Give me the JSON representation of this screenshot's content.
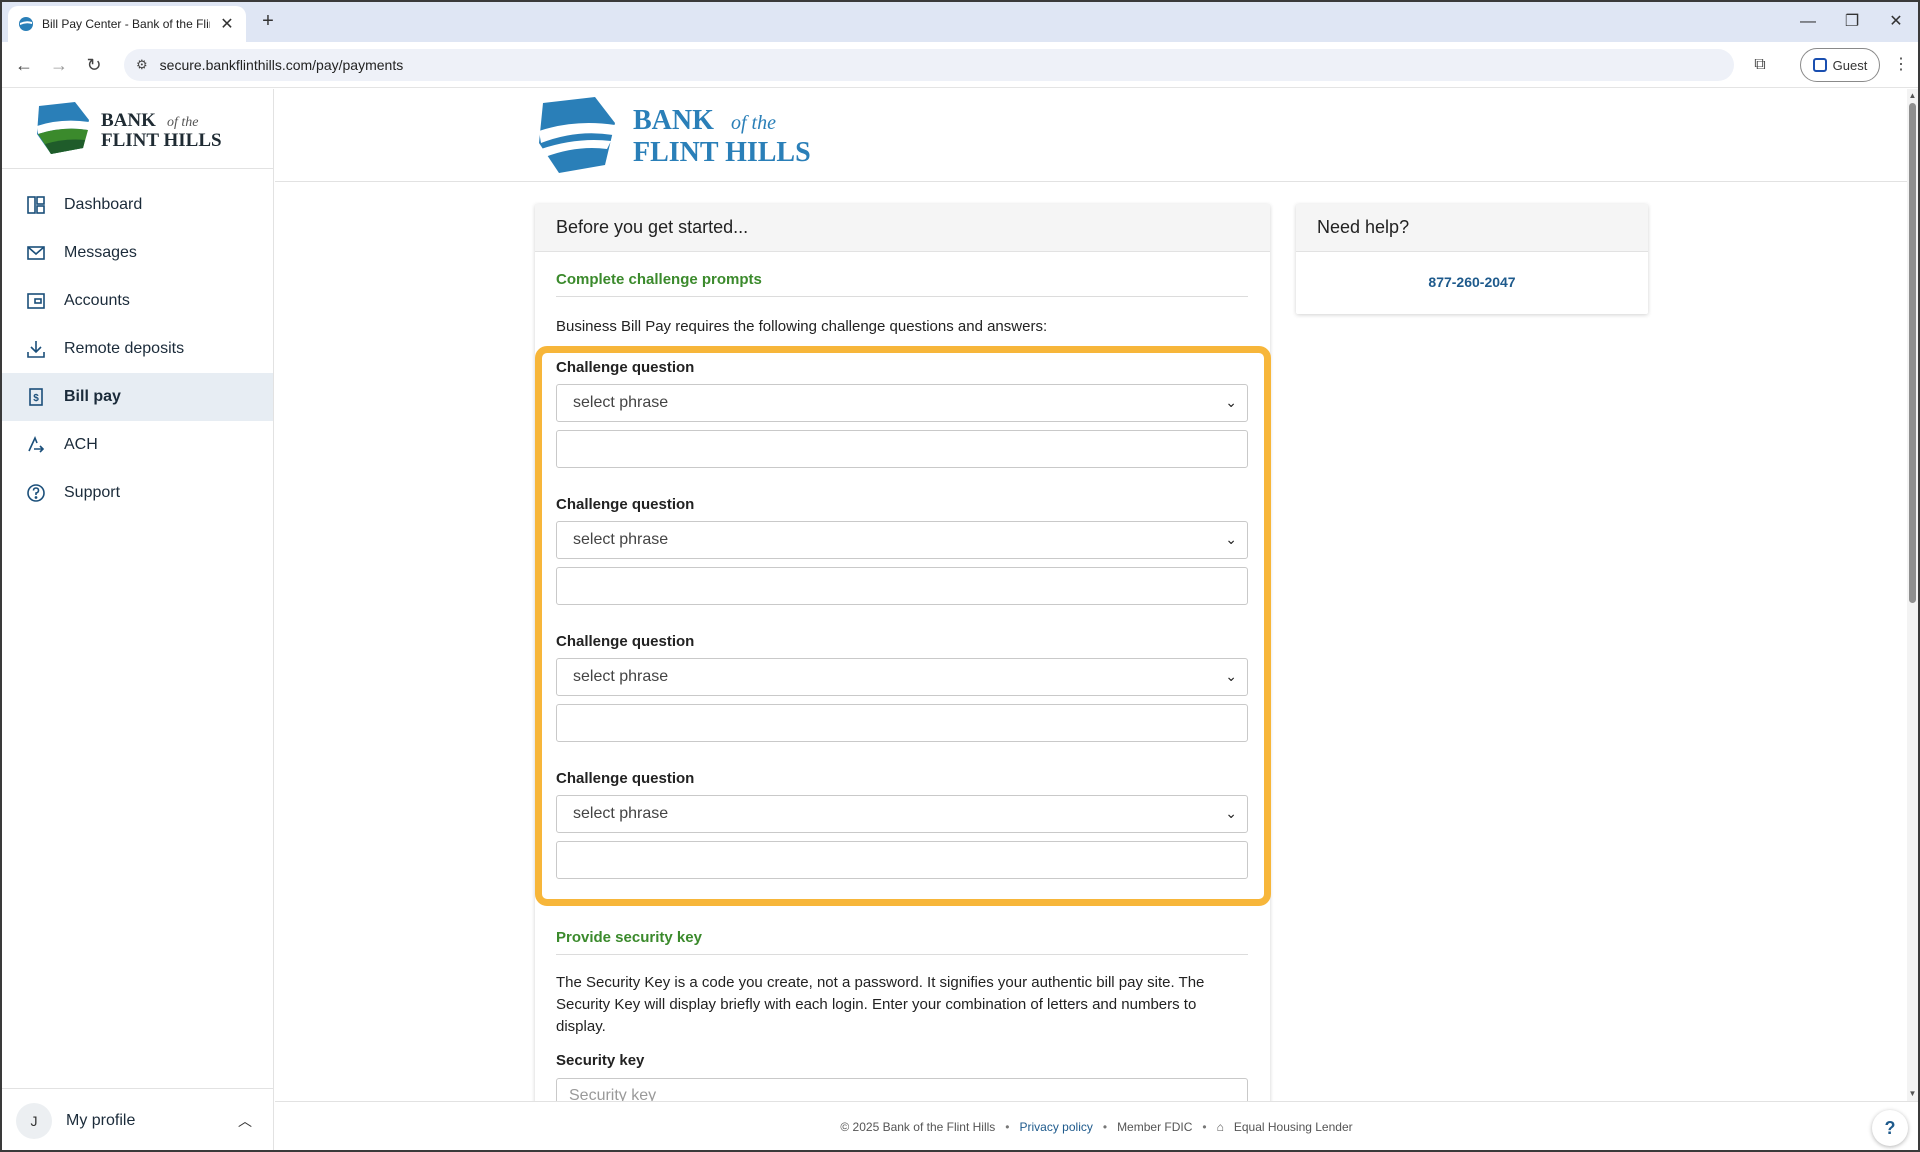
{
  "browser": {
    "tab_title": "Bill Pay Center - Bank of the Flin",
    "url": "secure.bankflinthills.com/pay/payments",
    "profile_label": "Guest"
  },
  "brand": {
    "line1": "BANK",
    "line1_small": "of the",
    "line2": "FLINT HILLS",
    "colors": {
      "blue": "#2a7fb8",
      "green": "#3b8a2c",
      "dark_green": "#1f5c2a",
      "accent": "#f7b63a"
    }
  },
  "sidebar": {
    "items": [
      {
        "label": "Dashboard",
        "icon": "dashboard-icon"
      },
      {
        "label": "Messages",
        "icon": "envelope-icon"
      },
      {
        "label": "Accounts",
        "icon": "wallet-icon"
      },
      {
        "label": "Remote deposits",
        "icon": "download-icon"
      },
      {
        "label": "Bill pay",
        "icon": "dollar-bill-icon",
        "active": true
      },
      {
        "label": "ACH",
        "icon": "transfer-icon"
      },
      {
        "label": "Support",
        "icon": "help-circle-icon"
      }
    ],
    "profile": {
      "initial": "J",
      "label": "My profile"
    }
  },
  "form": {
    "header": "Before you get started...",
    "challenge_section": "Complete challenge prompts",
    "intro": "Business Bill Pay requires the following challenge questions and answers:",
    "questions": [
      {
        "label": "Challenge question",
        "select": "select phrase",
        "answer": ""
      },
      {
        "label": "Challenge question",
        "select": "select phrase",
        "answer": ""
      },
      {
        "label": "Challenge question",
        "select": "select phrase",
        "answer": ""
      },
      {
        "label": "Challenge question",
        "select": "select phrase",
        "answer": ""
      }
    ],
    "security_section": "Provide security key",
    "security_text": "The Security Key is a code you create, not a password. It signifies your authentic bill pay site. The Security Key will display briefly with each login. Enter your combination of letters and numbers to display.",
    "security_label": "Security key",
    "security_placeholder": "Security key"
  },
  "help": {
    "header": "Need help?",
    "phone": "877-260-2047"
  },
  "footer": {
    "copyright": "© 2025 Bank of the Flint Hills",
    "privacy": "Privacy policy",
    "fdic": "Member FDIC",
    "housing": "Equal Housing Lender",
    "sep": "•"
  }
}
